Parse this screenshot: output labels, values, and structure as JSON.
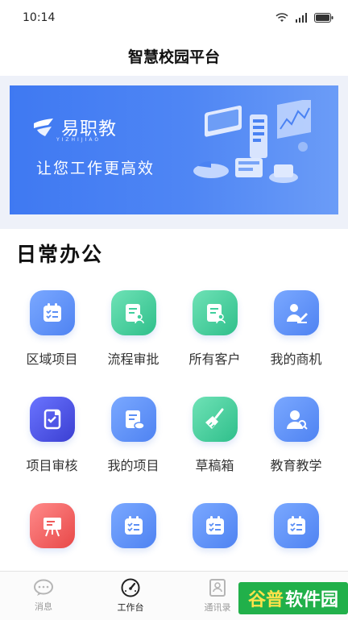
{
  "status_bar": {
    "time": "10:14"
  },
  "header": {
    "title": "智慧校园平台"
  },
  "banner": {
    "brand_name": "易职教",
    "brand_pinyin": "YIZHIJIAO",
    "slogan": "让您工作更高效",
    "accent": "#4a82f3"
  },
  "section": {
    "title": "日常办公"
  },
  "apps": [
    {
      "label": "区域项目",
      "icon": "checklist-icon",
      "color": "#5b8ff5"
    },
    {
      "label": "流程审批",
      "icon": "document-user-icon",
      "color": "#3fcf9c"
    },
    {
      "label": "所有客户",
      "icon": "document-user-icon",
      "color": "#3fcf9c"
    },
    {
      "label": "我的商机",
      "icon": "person-writing-icon",
      "color": "#5b8ff5"
    },
    {
      "label": "项目审核",
      "icon": "review-icon",
      "color": "#4e54e0"
    },
    {
      "label": "我的项目",
      "icon": "document-cloud-icon",
      "color": "#5b8ff5"
    },
    {
      "label": "草稿箱",
      "icon": "broom-icon",
      "color": "#3fcf9c"
    },
    {
      "label": "教育教学",
      "icon": "teacher-icon",
      "color": "#5b8ff5"
    },
    {
      "label": "",
      "icon": "easel-icon",
      "color": "#ef5a5a"
    },
    {
      "label": "",
      "icon": "checklist-icon",
      "color": "#5b8ff5"
    },
    {
      "label": "",
      "icon": "checklist-icon",
      "color": "#5b8ff5"
    },
    {
      "label": "",
      "icon": "checklist-icon",
      "color": "#5b8ff5"
    }
  ],
  "tabbar": [
    {
      "label": "消息",
      "icon": "chat-icon",
      "active": false
    },
    {
      "label": "工作台",
      "icon": "dashboard-gauge-icon",
      "active": true
    },
    {
      "label": "通讯录",
      "icon": "contacts-icon",
      "active": false
    },
    {
      "label": "",
      "icon": "profile-icon",
      "active": false
    }
  ],
  "watermark": {
    "part1": "谷普",
    "part2": "软件园"
  }
}
